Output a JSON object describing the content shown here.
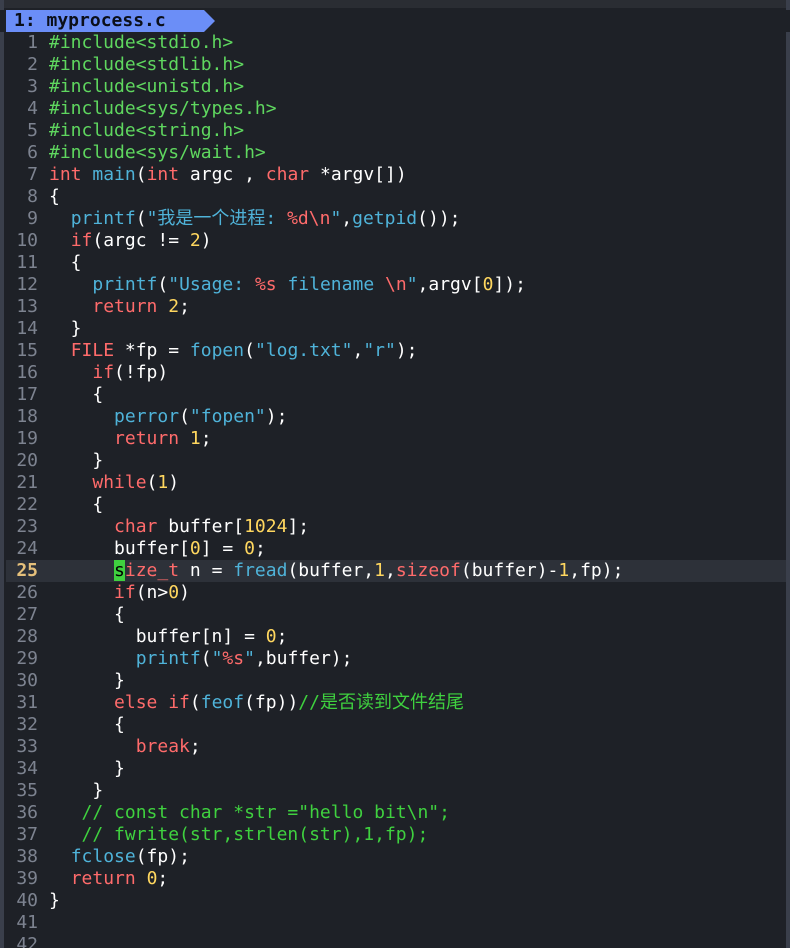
{
  "window": {
    "tab_label": "1: myprocess.c"
  },
  "colors": {
    "background": "#1e2127",
    "preprocessor": "#5fd75f",
    "keyword": "#ff6b6b",
    "function": "#4fb3d9",
    "string": "#4fb3d9",
    "number": "#ffd75f",
    "comment": "#3fd13f",
    "tab_active": "#6b8ef7",
    "current_line_number": "#e5c07b"
  },
  "editor": {
    "current_line": 25,
    "lines": [
      {
        "num": "1",
        "tokens": [
          [
            "pp",
            "#include<stdio.h>"
          ]
        ]
      },
      {
        "num": "2",
        "tokens": [
          [
            "pp",
            "#include<stdlib.h>"
          ]
        ]
      },
      {
        "num": "3",
        "tokens": [
          [
            "pp",
            "#include<unistd.h>"
          ]
        ]
      },
      {
        "num": "4",
        "tokens": [
          [
            "pp",
            "#include<sys/types.h>"
          ]
        ]
      },
      {
        "num": "5",
        "tokens": [
          [
            "pp",
            "#include<string.h>"
          ]
        ]
      },
      {
        "num": "6",
        "tokens": [
          [
            "pp",
            "#include<sys/wait.h>"
          ]
        ]
      },
      {
        "num": "7",
        "tokens": [
          [
            "kw",
            "int "
          ],
          [
            "fn",
            "main"
          ],
          [
            "plain",
            "("
          ],
          [
            "kw",
            "int"
          ],
          [
            "plain",
            " argc , "
          ],
          [
            "kw",
            "char"
          ],
          [
            "plain",
            " *argv[])"
          ]
        ]
      },
      {
        "num": "8",
        "tokens": [
          [
            "plain",
            "{"
          ]
        ]
      },
      {
        "num": "9",
        "tokens": [
          [
            "plain",
            "  "
          ],
          [
            "fn",
            "printf"
          ],
          [
            "plain",
            "("
          ],
          [
            "str",
            "\"我是一个进程: "
          ],
          [
            "esc",
            "%d\\n"
          ],
          [
            "str",
            "\""
          ],
          [
            "plain",
            ","
          ],
          [
            "fn",
            "getpid"
          ],
          [
            "plain",
            "());"
          ]
        ]
      },
      {
        "num": "10",
        "tokens": [
          [
            "plain",
            "  "
          ],
          [
            "kw",
            "if"
          ],
          [
            "plain",
            "(argc != "
          ],
          [
            "num",
            "2"
          ],
          [
            "plain",
            ")"
          ]
        ]
      },
      {
        "num": "11",
        "tokens": [
          [
            "plain",
            "  {"
          ]
        ]
      },
      {
        "num": "12",
        "tokens": [
          [
            "plain",
            "    "
          ],
          [
            "fn",
            "printf"
          ],
          [
            "plain",
            "("
          ],
          [
            "str",
            "\"Usage: "
          ],
          [
            "esc",
            "%s"
          ],
          [
            "str",
            " filename "
          ],
          [
            "esc",
            "\\n"
          ],
          [
            "str",
            "\""
          ],
          [
            "plain",
            ",argv["
          ],
          [
            "num",
            "0"
          ],
          [
            "plain",
            "]);"
          ]
        ]
      },
      {
        "num": "13",
        "tokens": [
          [
            "plain",
            "    "
          ],
          [
            "kw",
            "return"
          ],
          [
            "plain",
            " "
          ],
          [
            "num",
            "2"
          ],
          [
            "plain",
            ";"
          ]
        ]
      },
      {
        "num": "14",
        "tokens": [
          [
            "plain",
            "  }"
          ]
        ]
      },
      {
        "num": "15",
        "tokens": [
          [
            "plain",
            "  "
          ],
          [
            "kw",
            "FILE"
          ],
          [
            "plain",
            " *fp = "
          ],
          [
            "fn",
            "fopen"
          ],
          [
            "plain",
            "("
          ],
          [
            "str",
            "\"log.txt\""
          ],
          [
            "plain",
            ","
          ],
          [
            "str",
            "\"r\""
          ],
          [
            "plain",
            ");"
          ]
        ]
      },
      {
        "num": "16",
        "tokens": [
          [
            "plain",
            "    "
          ],
          [
            "kw",
            "if"
          ],
          [
            "plain",
            "(!fp)"
          ]
        ]
      },
      {
        "num": "17",
        "tokens": [
          [
            "plain",
            "    {"
          ]
        ]
      },
      {
        "num": "18",
        "tokens": [
          [
            "plain",
            "      "
          ],
          [
            "fn",
            "perror"
          ],
          [
            "plain",
            "("
          ],
          [
            "str",
            "\"fopen\""
          ],
          [
            "plain",
            ");"
          ]
        ]
      },
      {
        "num": "19",
        "tokens": [
          [
            "plain",
            "      "
          ],
          [
            "kw",
            "return"
          ],
          [
            "plain",
            " "
          ],
          [
            "num",
            "1"
          ],
          [
            "plain",
            ";"
          ]
        ]
      },
      {
        "num": "20",
        "tokens": [
          [
            "plain",
            "    }"
          ]
        ]
      },
      {
        "num": "21",
        "tokens": [
          [
            "plain",
            "    "
          ],
          [
            "kw",
            "while"
          ],
          [
            "plain",
            "("
          ],
          [
            "num",
            "1"
          ],
          [
            "plain",
            ")"
          ]
        ]
      },
      {
        "num": "22",
        "tokens": [
          [
            "plain",
            "    {"
          ]
        ]
      },
      {
        "num": "23",
        "tokens": [
          [
            "plain",
            "      "
          ],
          [
            "kw",
            "char"
          ],
          [
            "plain",
            " buffer["
          ],
          [
            "num",
            "1024"
          ],
          [
            "plain",
            "];"
          ]
        ]
      },
      {
        "num": "24",
        "tokens": [
          [
            "plain",
            "      buffer["
          ],
          [
            "num",
            "0"
          ],
          [
            "plain",
            "] = "
          ],
          [
            "num",
            "0"
          ],
          [
            "plain",
            ";"
          ]
        ]
      },
      {
        "num": "25",
        "tokens": [
          [
            "plain",
            "      "
          ],
          [
            "cursor",
            "s"
          ],
          [
            "kw",
            "ize_t"
          ],
          [
            "plain",
            " n = "
          ],
          [
            "fn",
            "fread"
          ],
          [
            "plain",
            "(buffer,"
          ],
          [
            "num",
            "1"
          ],
          [
            "plain",
            ","
          ],
          [
            "kw",
            "sizeof"
          ],
          [
            "plain",
            "(buffer)-"
          ],
          [
            "num",
            "1"
          ],
          [
            "plain",
            ",fp);"
          ]
        ]
      },
      {
        "num": "26",
        "tokens": [
          [
            "plain",
            "      "
          ],
          [
            "kw",
            "if"
          ],
          [
            "plain",
            "(n>"
          ],
          [
            "num",
            "0"
          ],
          [
            "plain",
            ")"
          ]
        ]
      },
      {
        "num": "27",
        "tokens": [
          [
            "plain",
            "      {"
          ]
        ]
      },
      {
        "num": "28",
        "tokens": [
          [
            "plain",
            "        buffer[n] = "
          ],
          [
            "num",
            "0"
          ],
          [
            "plain",
            ";"
          ]
        ]
      },
      {
        "num": "29",
        "tokens": [
          [
            "plain",
            "        "
          ],
          [
            "fn",
            "printf"
          ],
          [
            "plain",
            "("
          ],
          [
            "str",
            "\""
          ],
          [
            "esc",
            "%s"
          ],
          [
            "str",
            "\""
          ],
          [
            "plain",
            ",buffer);"
          ]
        ]
      },
      {
        "num": "30",
        "tokens": [
          [
            "plain",
            "      }"
          ]
        ]
      },
      {
        "num": "31",
        "tokens": [
          [
            "plain",
            "      "
          ],
          [
            "kw",
            "else if"
          ],
          [
            "plain",
            "("
          ],
          [
            "fn",
            "feof"
          ],
          [
            "plain",
            "(fp))"
          ],
          [
            "cm",
            "//是否读到文件结尾"
          ]
        ]
      },
      {
        "num": "32",
        "tokens": [
          [
            "plain",
            "      {"
          ]
        ]
      },
      {
        "num": "33",
        "tokens": [
          [
            "plain",
            "        "
          ],
          [
            "kw",
            "break"
          ],
          [
            "plain",
            ";"
          ]
        ]
      },
      {
        "num": "34",
        "tokens": [
          [
            "plain",
            "      }"
          ]
        ]
      },
      {
        "num": "35",
        "tokens": [
          [
            "plain",
            "    }"
          ]
        ]
      },
      {
        "num": "36",
        "tokens": [
          [
            "plain",
            "   "
          ],
          [
            "cm",
            "// const char *str =\"hello bit\\n\";"
          ]
        ]
      },
      {
        "num": "37",
        "tokens": [
          [
            "plain",
            "   "
          ],
          [
            "cm",
            "// fwrite(str,strlen(str),1,fp);"
          ]
        ]
      },
      {
        "num": "38",
        "tokens": [
          [
            "plain",
            "  "
          ],
          [
            "fn",
            "fclose"
          ],
          [
            "plain",
            "(fp);"
          ]
        ]
      },
      {
        "num": "39",
        "tokens": [
          [
            "plain",
            "  "
          ],
          [
            "kw",
            "return"
          ],
          [
            "plain",
            " "
          ],
          [
            "num",
            "0"
          ],
          [
            "plain",
            ";"
          ]
        ]
      },
      {
        "num": "40",
        "tokens": [
          [
            "plain",
            "}"
          ]
        ]
      },
      {
        "num": "41",
        "tokens": []
      },
      {
        "num": "42",
        "tokens": []
      }
    ]
  }
}
